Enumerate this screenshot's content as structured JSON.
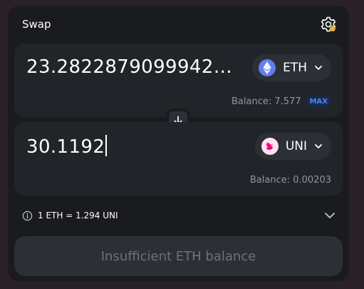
{
  "swap": {
    "title": "Swap"
  },
  "input": {
    "amount": "23.2822879099942…",
    "token": "ETH",
    "balance_label": "Balance: 7.577",
    "max_label": "MAX"
  },
  "output": {
    "amount": "30.1192",
    "token": "UNI",
    "balance_label": "Balance: 0.00203"
  },
  "rate": {
    "text": "1 ETH = 1.294 UNI"
  },
  "action": {
    "button_label": "Insufficient ETH balance"
  },
  "colors": {
    "eth": "#627eea",
    "uni": "#ff007a",
    "max_accent": "#4c82fb"
  },
  "icons": [
    "gear-icon",
    "eth-token-icon",
    "uni-token-icon",
    "chevron-down-icon",
    "arrow-down-icon",
    "info-icon"
  ]
}
